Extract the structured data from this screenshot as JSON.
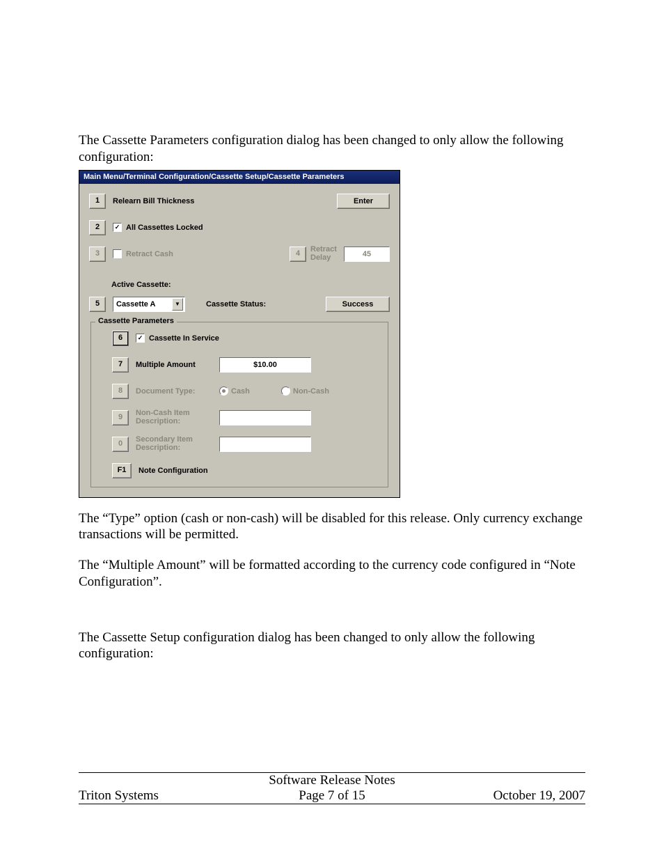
{
  "doc": {
    "para1": "The Cassette Parameters configuration dialog has been changed to only allow the following configuration:",
    "para2a": "The “Type” option (cash or non-cash) will be disabled for this release. Only currency exchange transactions will be permitted.",
    "para2b": "The “Multiple Amount” will be formatted according to the currency code configured in “Note Configuration”.",
    "para3": "The Cassette Setup configuration dialog has been changed to only allow the following configuration:"
  },
  "dlg": {
    "title": "Main Menu/Terminal Configuration/Cassette Setup/Cassette Parameters",
    "key1": "1",
    "relearn": "Relearn Bill Thickness",
    "enter": "Enter",
    "key2": "2",
    "all_locked": "All Cassettes Locked",
    "all_locked_checked": "✓",
    "key3": "3",
    "retract_cash": "Retract Cash",
    "key4": "4",
    "retract_delay": "Retract Delay",
    "retract_delay_val": "45",
    "active_cassette_lbl": "Active Cassette:",
    "key5": "5",
    "cassette_sel": "Cassette A",
    "cassette_status_lbl": "Cassette Status:",
    "cassette_status_val": "Success",
    "group": "Cassette Parameters",
    "key6": "6",
    "in_service": "Cassette In Service",
    "in_service_checked": "✓",
    "key7": "7",
    "multi_amount": "Multiple Amount",
    "multi_amount_val": "$10.00",
    "key8": "8",
    "doc_type": "Document Type:",
    "radio_cash": "Cash",
    "radio_noncash": "Non-Cash",
    "key9": "9",
    "noncash_desc": "Non-Cash Item Description:",
    "key0": "0",
    "secondary_desc": "Secondary Item Description:",
    "keyF1": "F1",
    "note_config": "Note Configuration"
  },
  "footer": {
    "title": "Software Release Notes",
    "left": "Triton Systems",
    "center": "Page 7 of 15",
    "right": "October 19, 2007"
  }
}
